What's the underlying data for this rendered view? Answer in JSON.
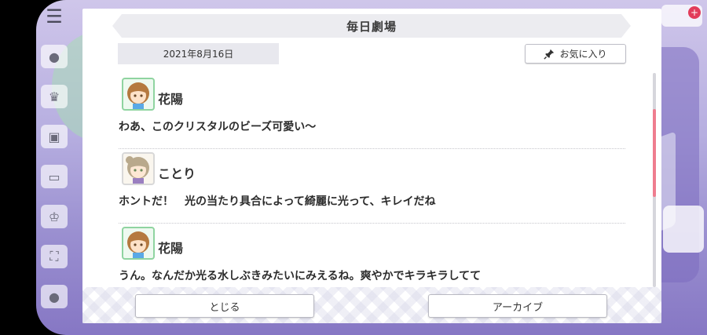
{
  "dialog": {
    "title": "毎日劇場",
    "date": "2021年8月16日",
    "favorite_label": "お気に入り"
  },
  "messages": [
    {
      "speaker": "花陽",
      "text": "わあ、このクリスタルのビーズ可愛い〜",
      "avatar": "hanayo-avatar"
    },
    {
      "speaker": "ことり",
      "text": "ホントだ！　光の当たり具合によって綺麗に光って、キレイだね",
      "avatar": "kotori-avatar"
    },
    {
      "speaker": "花陽",
      "text": "うん。なんだか光る水しぶきみたいにみえるね。爽やかでキラキラしてて",
      "avatar": "hanayo-avatar"
    }
  ],
  "footer": {
    "close_label": "とじる",
    "archive_label": "アーカイブ"
  },
  "colors": {
    "accent_scroll": "#ef7d8f",
    "hanayo_frame": "#8fd4a0"
  }
}
